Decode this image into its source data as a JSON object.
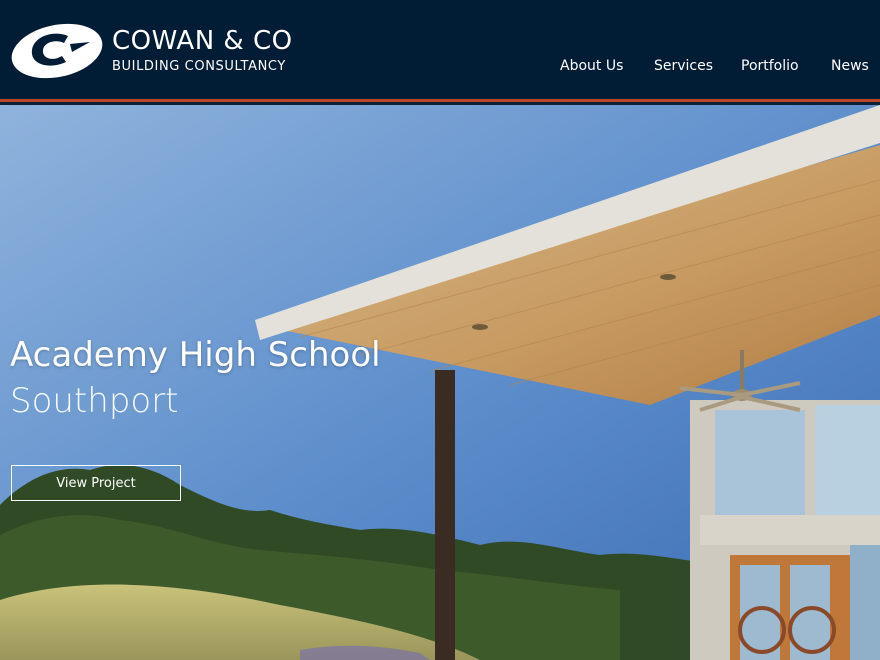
{
  "brand": {
    "name": "COWAN & CO",
    "subtitle": "BUILDING CONSULTANCY",
    "logo_icon": "c-swoosh-logo-icon"
  },
  "nav": {
    "items": [
      {
        "label": "About Us"
      },
      {
        "label": "Services"
      },
      {
        "label": "Portfolio"
      },
      {
        "label": "News"
      }
    ]
  },
  "hero": {
    "title": "Academy High School",
    "subtitle": "Southport",
    "button_label": "View Project"
  },
  "colors": {
    "header_bg": "#011c35",
    "accent_rule": "#b8472a",
    "text": "#ffffff"
  }
}
